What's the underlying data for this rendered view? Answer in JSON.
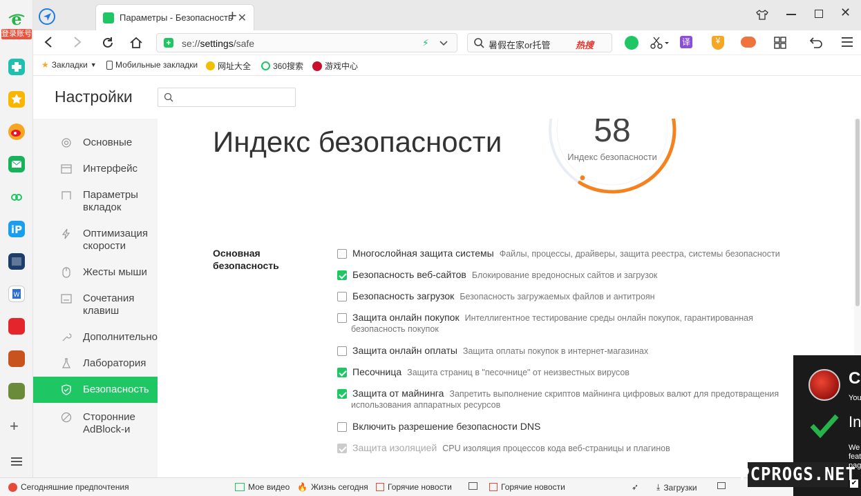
{
  "browser": {
    "tab_title": "Параметры - Безопасность",
    "login_label": "登录账号",
    "url_prefix": "se://",
    "url_bold": "settings",
    "url_suffix": "/safe",
    "search_text": "暑假在家or托管",
    "hot_label": "热搜",
    "translate_label": "译",
    "new_tab_symbol": "+"
  },
  "bookmarks": {
    "items": [
      "Закладки",
      "Мобильные закладки",
      "网址大全",
      "360搜索",
      "游戏中心"
    ]
  },
  "settings": {
    "title": "Настройки",
    "search_placeholder": ""
  },
  "sidebar": {
    "items": [
      {
        "label": "Основные",
        "icon": "settings-icon"
      },
      {
        "label": "Интерфейс",
        "icon": "interface-icon"
      },
      {
        "label": "Параметры вкладок",
        "icon": "tab-icon"
      },
      {
        "label": "Оптимизация скорости",
        "icon": "lightning-icon"
      },
      {
        "label": "Жесты мыши",
        "icon": "mouse-icon"
      },
      {
        "label": "Сочетания клавиш",
        "icon": "keyboard-icon"
      },
      {
        "label": "Дополнительно",
        "icon": "wrench-icon"
      },
      {
        "label": "Лаборатория",
        "icon": "flask-icon"
      },
      {
        "label": "Безопасность",
        "icon": "shield-icon",
        "active": true
      },
      {
        "label": "Сторонние AdBlock-и",
        "icon": "block-icon"
      }
    ]
  },
  "security": {
    "heading": "Индекс безопасности",
    "score": "58",
    "score_label": "Индекс безопасности",
    "score_fraction": 0.58,
    "section_title": "Основная безопасность",
    "options": [
      {
        "label": "Многослойная защита системы",
        "desc": "Файлы, процессы, драйверы, защита реестра, системы безопасности",
        "checked": false
      },
      {
        "label": "Безопасность веб-сайтов",
        "desc": "Блокирование вредоносных сайтов и загрузок",
        "checked": true
      },
      {
        "label": "Безопасность загрузок",
        "desc": "Безопасность загружаемых файлов и антитроян",
        "checked": false
      },
      {
        "label": "Защита онлайн покупок",
        "desc": "Интеллигентное тестирование среды онлайн покупок, гарантированная",
        "desc2": "безопасность покупок",
        "checked": false
      },
      {
        "label": "Защита онлайн оплаты",
        "desc": "Защита оплаты покупок в интернет-магазинах",
        "checked": false
      },
      {
        "label": "Песочница",
        "desc": "Защита страниц в \"песочнице\" от неизвестных вирусов",
        "checked": true
      },
      {
        "label": "Защита от майнинга",
        "desc": "Запретить выполнение скриптов майнинга цифровых валют для предотвращения",
        "desc2": "использования аппаратных ресурсов",
        "checked": true
      },
      {
        "label": "Включить разрешение безопасности DNS",
        "desc": "",
        "checked": false
      },
      {
        "label": "Защита изоляцией",
        "desc": "CPU изоляция процессов кода веб-страницы и плагинов",
        "checked": true,
        "disabled": true
      }
    ]
  },
  "statusbar": {
    "items": [
      "Сегодняшние предпочтения",
      "Мое видео",
      "Жизнь сегодня",
      "Горячие новости",
      "Горячие новости",
      "Загрузки"
    ]
  },
  "notification": {
    "title": "Co",
    "line1": "You",
    "line2": "In",
    "line3": "We",
    "line4": "feat",
    "line5": "pag"
  },
  "watermark": "PCPROGS.NET",
  "colors": {
    "accent": "#1ec764",
    "ring_orange": "#f5821f",
    "ring_track": "#e9eef5"
  }
}
